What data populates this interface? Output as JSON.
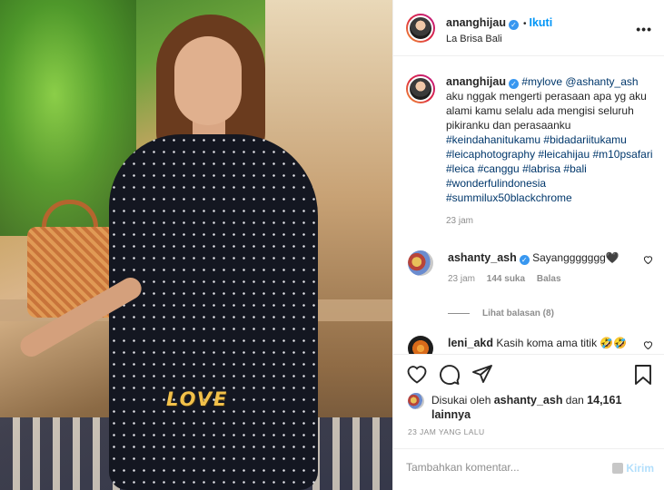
{
  "post": {
    "username": "ananghijau",
    "follow_label": "Ikuti",
    "location": "La Brisa Bali",
    "more_label": "•••",
    "overlay_text": "LOVE"
  },
  "caption": {
    "username": "ananghijau",
    "text_1": "#mylove @ashanty_ash",
    "text_2": "aku nggak mengerti perasaan apa yg aku alami kamu selalu ada mengisi seluruh pikiranku dan perasaanku",
    "hashtags": "#keindahanitukamu #bidadariitukamu #leicaphotography #leicahijau #m10psafari #leica #canggu #labrisa #bali #wonderfulindonesia #summilux50blackchrome",
    "time": "23 jam"
  },
  "comments": [
    {
      "username": "ashanty_ash",
      "text": "Sayanggggggg🖤",
      "time": "23 jam",
      "likes": "144 suka",
      "reply": "Balas"
    },
    {
      "username": "leni_akd",
      "text": "Kasih koma ama titik 🤣🤣"
    }
  ],
  "view_replies": "Lihat balasan (8)",
  "likes": {
    "prefix": "Disukai oleh",
    "user": "ashanty_ash",
    "conjunction": "dan",
    "count": "14,161 lainnya"
  },
  "timestamp": "23 JAM YANG LALU",
  "add_comment": {
    "placeholder": "Tambahkan komentar...",
    "send_label": "Kirim"
  },
  "colors": {
    "accent": "#0095f6",
    "hashtag": "#00376b",
    "muted": "#8e8e8e",
    "verified": "#3897f0",
    "overlay_text": "#f2c14a"
  }
}
